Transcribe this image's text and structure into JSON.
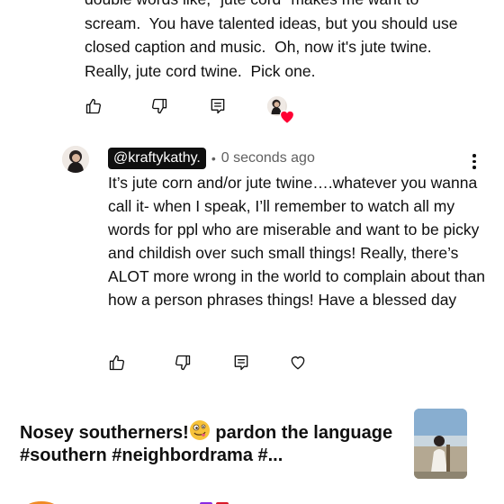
{
  "parent_comment": {
    "text": "double words like, \"jute cord\" makes me want to scream.  You have talented ideas, but you should use closed caption and music.  Oh, now it's jute twine.  Really, jute cord twine.  Pick one."
  },
  "reply": {
    "handle": "@kraftykathy.",
    "separator": "•",
    "timestamp": "0 seconds ago",
    "text": "It’s jute corn and/or jute twine….whatever you wanna call it- when I speak, I’ll remember to watch all my words for ppl who are miserable and want to be picky and childish over such small things! Really, there’s ALOT more wrong in the world to complain about than how a person phrases things! Have a blessed day"
  },
  "video": {
    "title_part1": "Nosey southerners!",
    "emoji": "zany-face-emoji",
    "title_part2": " pardon the language #southern #neighbordrama #..."
  },
  "colors": {
    "text": "#0f0f0f",
    "secondary": "#606060",
    "heart": "#ff0033",
    "chip_bg": "#0f0f0f"
  }
}
